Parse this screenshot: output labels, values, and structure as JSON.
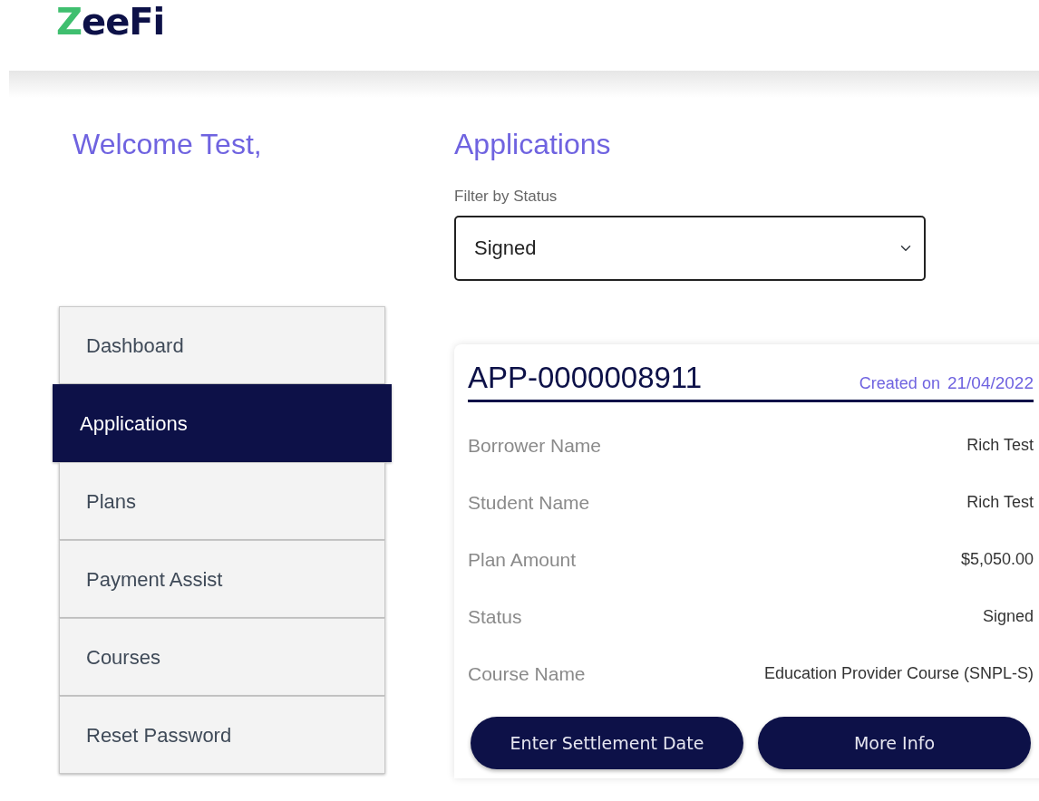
{
  "logo": "ZeeFi",
  "welcome": "Welcome Test,",
  "sidebar": {
    "items": [
      {
        "label": "Dashboard",
        "selected": false
      },
      {
        "label": "Applications",
        "selected": true
      },
      {
        "label": "Plans",
        "selected": false
      },
      {
        "label": "Payment Assist",
        "selected": false
      },
      {
        "label": "Courses",
        "selected": false
      },
      {
        "label": "Reset Password",
        "selected": false
      }
    ]
  },
  "page_title": "Applications",
  "filter": {
    "label": "Filter by Status",
    "value": "Signed"
  },
  "application": {
    "id": "APP-0000008911",
    "created_label": "Created on",
    "created_date": "21/04/2022",
    "fields": [
      {
        "label": "Borrower Name",
        "value": "Rich Test"
      },
      {
        "label": "Student Name",
        "value": "Rich Test"
      },
      {
        "label": "Plan Amount",
        "value": "$5,050.00"
      },
      {
        "label": "Status",
        "value": "Signed"
      },
      {
        "label": "Course Name",
        "value": "Education Provider Course (SNPL-S)"
      }
    ],
    "buttons": [
      "Enter Settlement Date",
      "More Info"
    ]
  }
}
